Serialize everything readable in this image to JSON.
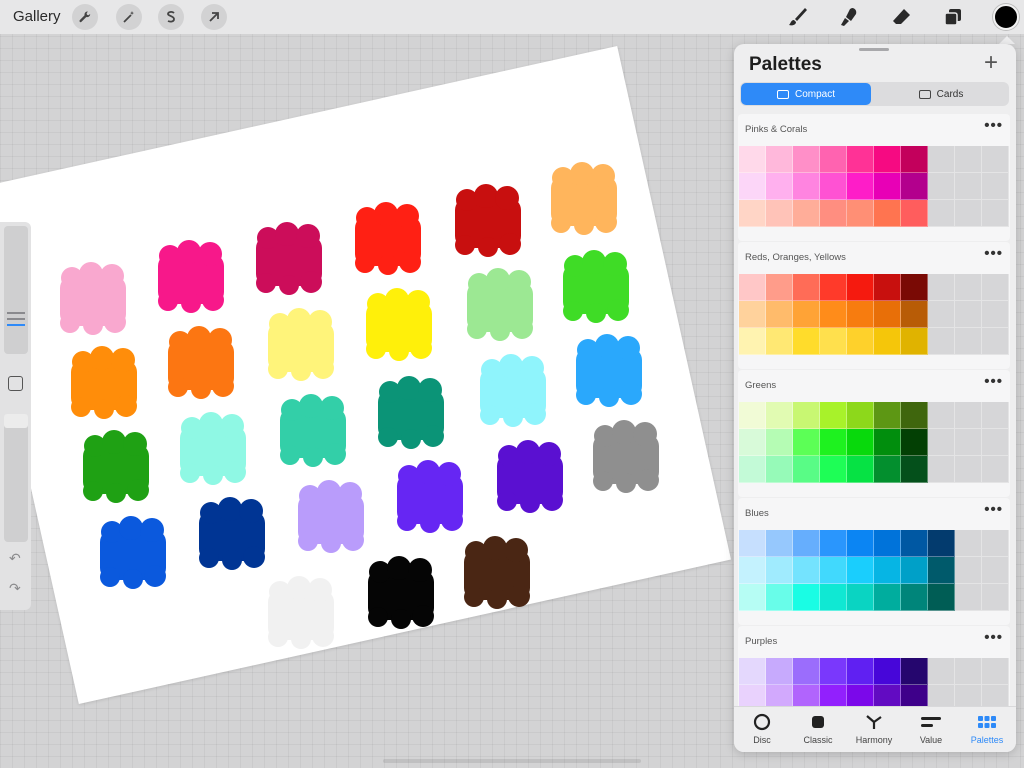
{
  "toolbar": {
    "gallery_label": "Gallery",
    "left_tools": [
      "wrench-icon",
      "magic-wand-icon",
      "selection-icon",
      "transform-arrow-icon"
    ],
    "right_tools": [
      "brush-icon",
      "smudge-icon",
      "eraser-icon",
      "layers-icon"
    ],
    "current_color": "#000000"
  },
  "canvas": {
    "swatch_colors": [
      "#f9a8cf",
      "#f7188a",
      "#cc0d5a",
      "#ff2014",
      "#c80f0f",
      "#ffb55c",
      "#ff8d0a",
      "#fc7612",
      "#fff47a",
      "#fff00a",
      "#9ce893",
      "#3fdc26",
      "#1fa114",
      "#8ff8e4",
      "#33cfa8",
      "#0b9477",
      "#8ff4fc",
      "#2aa8fc",
      "#0b59dd",
      "#003594",
      "#b99cfb",
      "#6626f3",
      "#5a10d1",
      "#8f8f8f",
      "#f1f1f1",
      "#050505",
      "#4a2614"
    ]
  },
  "sidebar": {
    "size_slider_label": "brush-size-slider",
    "opacity_slider_label": "opacity-slider",
    "undo_glyph": "↶",
    "redo_glyph": "↷"
  },
  "panel": {
    "title": "Palettes",
    "add_label": "+",
    "segments": [
      {
        "label": "Compact",
        "active": true
      },
      {
        "label": "Cards",
        "active": false
      }
    ],
    "palettes": [
      {
        "name": "Pinks & Corals",
        "more": "•••",
        "rows": [
          [
            "#ffd9ea",
            "#ffb8db",
            "#ff8fc8",
            "#ff63b0",
            "#ff3296",
            "#f60a82",
            "#c3005c"
          ],
          [
            "#fcd6f8",
            "#ffb0ee",
            "#ff84e0",
            "#ff52d3",
            "#fe1dc8",
            "#e800b6",
            "#b3008d"
          ],
          [
            "#ffd5c6",
            "#ffc3b8",
            "#ffad99",
            "#ff8e80",
            "#ff8f75",
            "#ff7450",
            "#ff5d5d"
          ]
        ]
      },
      {
        "name": "Reds, Oranges, Yellows",
        "more": "•••",
        "rows": [
          [
            "#ffc7c7",
            "#ff9c8a",
            "#ff6c57",
            "#ff3a2a",
            "#f51a0f",
            "#c8100e",
            "#7a0a05"
          ],
          [
            "#ffd29c",
            "#ffbb6b",
            "#ffa336",
            "#ff8c1a",
            "#f77c0f",
            "#e86f08",
            "#b85c06"
          ],
          [
            "#fff3b0",
            "#ffe873",
            "#ffdc2b",
            "#ffe04d",
            "#fed12b",
            "#f5c60a",
            "#e0b300"
          ]
        ]
      },
      {
        "name": "Greens",
        "more": "•••",
        "rows": [
          [
            "#f1fbd6",
            "#e1fbb2",
            "#c8f772",
            "#a8f22a",
            "#8dd81b",
            "#5d9714",
            "#3f660d"
          ],
          [
            "#d8fad9",
            "#b5fcb4",
            "#5cff56",
            "#1ef21f",
            "#08d90c",
            "#018e0d",
            "#034004"
          ],
          [
            "#c3fad7",
            "#96fab8",
            "#59fc86",
            "#1efe56",
            "#06e244",
            "#038f2e",
            "#04501b"
          ]
        ]
      },
      {
        "name": "Blues",
        "more": "•••",
        "rows": [
          [
            "#c6dffe",
            "#96c8fd",
            "#66aefd",
            "#2a96fd",
            "#0b85f3",
            "#0073da",
            "#0058a3",
            "#033b6e"
          ],
          [
            "#c4f2fe",
            "#a0ebfe",
            "#74e3fe",
            "#41d9fd",
            "#1acefd",
            "#06b5e4",
            "#00a0c8",
            "#005a6b"
          ],
          [
            "#b6fdf4",
            "#68fde9",
            "#1afde4",
            "#10e8d3",
            "#0ad4c2",
            "#00ad9e",
            "#00857a",
            "#005d55"
          ]
        ]
      },
      {
        "name": "Purples",
        "more": "•••",
        "rows": [
          [
            "#e4d8fd",
            "#c7aafd",
            "#9b6dfc",
            "#7a38fc",
            "#6020f2",
            "#4706d9",
            "#25066e"
          ],
          [
            "#e9d2fd",
            "#d2a9fd",
            "#b164fd",
            "#9220fd",
            "#7b08ea",
            "#620bc2",
            "#3e008a"
          ]
        ]
      }
    ],
    "tabs": [
      {
        "label": "Disc",
        "icon": "disc-icon"
      },
      {
        "label": "Classic",
        "icon": "classic-square-icon"
      },
      {
        "label": "Harmony",
        "icon": "harmony-icon"
      },
      {
        "label": "Value",
        "icon": "value-sliders-icon"
      },
      {
        "label": "Palettes",
        "icon": "palettes-grid-icon",
        "active": true
      }
    ]
  }
}
